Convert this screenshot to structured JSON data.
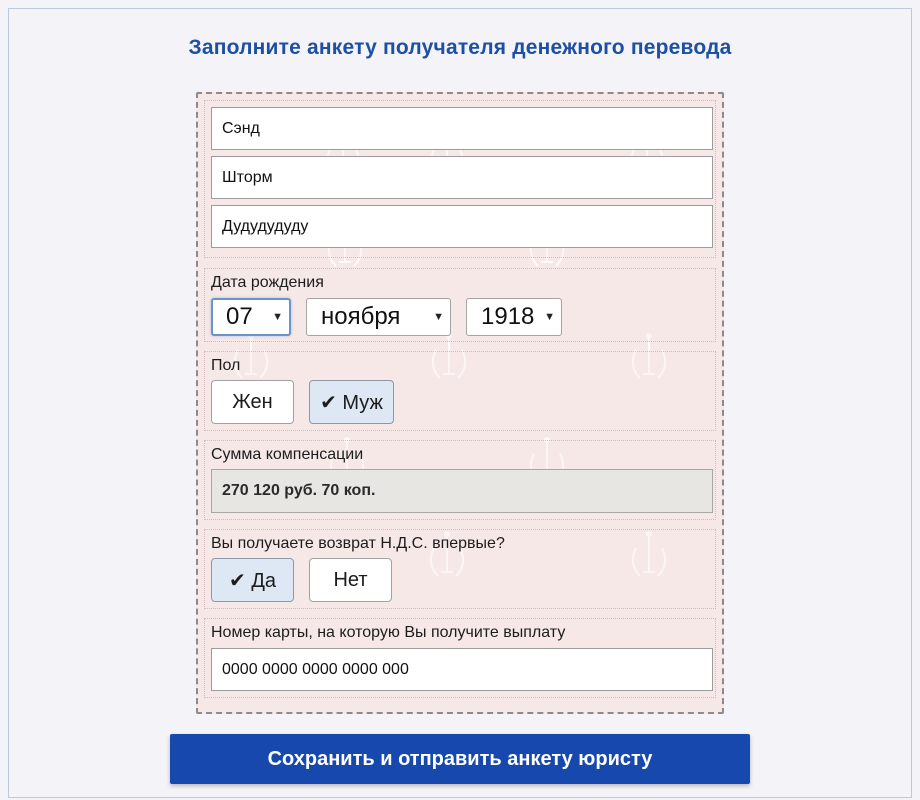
{
  "title": "Заполните анкету получателя денежного перевода",
  "name_fields": {
    "first_name": "Сэнд",
    "last_name": "Шторм",
    "middle_name": "Дудудудуду"
  },
  "birth_date": {
    "label": "Дата рождения",
    "day": "07",
    "month": "ноября",
    "year": "1918"
  },
  "gender": {
    "label": "Пол",
    "options": [
      "Жен",
      "✔ Муж"
    ],
    "selected": "Муж"
  },
  "compensation": {
    "label": "Сумма компенсации",
    "value": "270 120 руб. 70 коп."
  },
  "vat_first_time": {
    "label": "Вы получаете возврат Н.Д.С. впервые?",
    "options": [
      "✔ Да",
      "Нет"
    ],
    "selected": "Да"
  },
  "card": {
    "label": "Номер карты, на которую Вы получите выплату",
    "value": "0000 0000 0000 0000 000"
  },
  "submit_label": "Сохранить и отправить анкету юристу",
  "colors": {
    "title": "#1d4fa3",
    "submit_bg": "#1648ae",
    "form_bg": "#f7e8e8",
    "selected_toggle": "#dde8f4"
  },
  "icons": {
    "watermark": "themis-emblem-icon",
    "dropdown_arrow": "chevron-down-icon",
    "check": "checkmark-icon"
  }
}
